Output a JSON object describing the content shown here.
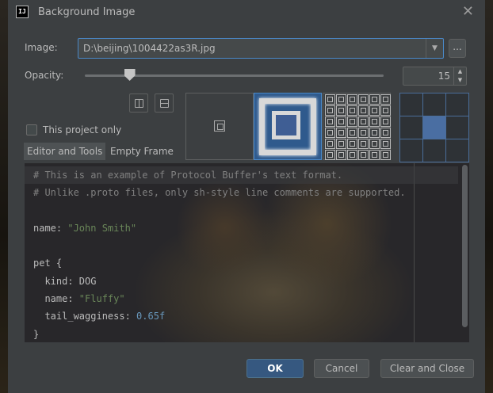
{
  "window": {
    "title": "Background Image",
    "icon_text": "IJ"
  },
  "image": {
    "label": "Image:",
    "path": "D:\\beijing\\1004422as3R.jpg",
    "browse_label": "..."
  },
  "opacity": {
    "label": "Opacity:",
    "value": "15",
    "level_percent": 15
  },
  "this_project_only": {
    "label": "This project only",
    "checked": false
  },
  "tabs": [
    {
      "label": "Editor and Tools",
      "selected": true
    },
    {
      "label": "Empty Frame",
      "selected": false
    }
  ],
  "fill_modes": [
    {
      "name": "plain",
      "selected": false
    },
    {
      "name": "scale",
      "selected": true
    },
    {
      "name": "tile",
      "selected": false
    }
  ],
  "anchor": {
    "selected": "center"
  },
  "preview_lines": [
    [
      [
        "comment",
        "# This is an example of Protocol Buffer's text format."
      ]
    ],
    [
      [
        "comment",
        "# Unlike .proto files, only sh-style line comments are supported."
      ]
    ],
    [],
    [
      [
        "plain",
        "name: "
      ],
      [
        "str",
        "\"John Smith\""
      ]
    ],
    [],
    [
      [
        "plain",
        "pet {"
      ]
    ],
    [
      [
        "plain",
        "  kind: DOG"
      ]
    ],
    [
      [
        "plain",
        "  name: "
      ],
      [
        "str",
        "\"Fluffy\""
      ]
    ],
    [
      [
        "plain",
        "  tail_wagginess: "
      ],
      [
        "num",
        "0.65f"
      ]
    ],
    [
      [
        "plain",
        "}"
      ]
    ]
  ],
  "buttons": {
    "ok": "OK",
    "cancel": "Cancel",
    "clear_close": "Clear and Close"
  },
  "colors": {
    "accent": "#4a88c7",
    "primary_button": "#365880",
    "string": "#6a8759",
    "number": "#6897bb",
    "comment": "#808080"
  }
}
